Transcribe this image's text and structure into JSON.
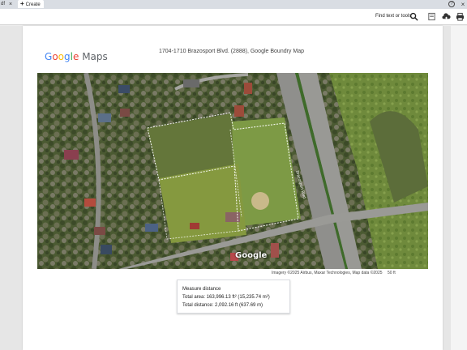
{
  "tabs": {
    "partial_label": "df",
    "close_glyph": "×",
    "active_label": "Create",
    "plus_glyph": "+"
  },
  "window": {
    "help_glyph": "?",
    "close_glyph": "×"
  },
  "toolbar": {
    "find_label": "Find text or tools",
    "icons": [
      "search-icon",
      "save-page-icon",
      "upload-icon",
      "print-icon"
    ]
  },
  "document": {
    "logo": {
      "google": [
        "G",
        "o",
        "o",
        "g",
        "l",
        "e"
      ],
      "maps": "Maps",
      "colors": [
        "#4285F4",
        "#EA4335",
        "#FBBC05",
        "#4285F4",
        "#34A853",
        "#EA4335"
      ]
    },
    "title": "1704-1710 Brazosport Blvd. (2888), Google Boundry Map",
    "map": {
      "watermark": "Google",
      "road_labels": [
        "Brazosport Blvd"
      ],
      "attribution": "Imagery ©2025 Airbus, Maxar Technologies, Map data ©2025",
      "scale": "50 ft"
    },
    "measure": {
      "title": "Measure distance",
      "area": "Total area: 163,996.13 ft² (15,235.74 m²)",
      "distance": "Total distance: 2,092.16 ft (637.69 m)"
    }
  }
}
